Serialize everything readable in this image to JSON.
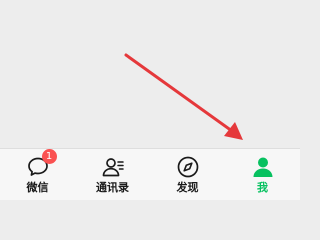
{
  "colors": {
    "background": "#ededed",
    "tabbar_background": "#f7f7f7",
    "active": "#07c160",
    "inactive": "#1a1a1a",
    "badge": "#fa5151",
    "annotation_arrow": "#e5383b"
  },
  "annotation": {
    "type": "arrow",
    "points_to": "tab-me",
    "icon": "red-arrow"
  },
  "tabbar": {
    "tabs": [
      {
        "label": "微信",
        "icon": "chat-bubble-icon",
        "badge": "1",
        "active": false
      },
      {
        "label": "通讯录",
        "icon": "contacts-icon",
        "active": false
      },
      {
        "label": "发现",
        "icon": "compass-icon",
        "active": false
      },
      {
        "label": "我",
        "icon": "person-icon",
        "active": true
      }
    ]
  }
}
